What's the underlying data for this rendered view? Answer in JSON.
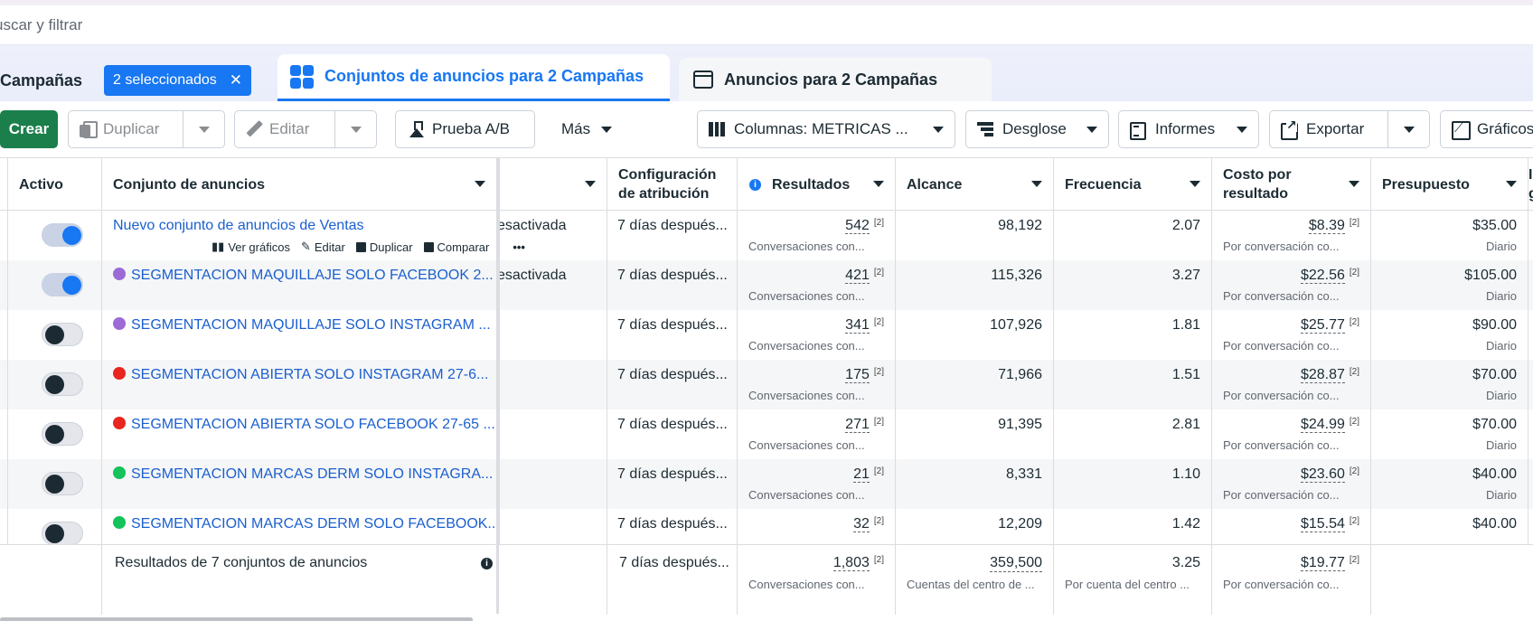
{
  "search": {
    "placeholder": "uscar y filtrar"
  },
  "tabs": {
    "campaigns_label": "Campañas",
    "selected_chip": "2 seleccionados",
    "adsets_label": "Conjuntos de anuncios para 2 Campañas",
    "ads_label": "Anuncios para 2 Campañas"
  },
  "toolbar": {
    "create": "Crear",
    "duplicate": "Duplicar",
    "edit": "Editar",
    "ab_test": "Prueba A/B",
    "more": "Más",
    "columns": "Columnas: METRICAS ...",
    "breakdown": "Desglose",
    "reports": "Informes",
    "export": "Exportar",
    "charts": "Gráficos"
  },
  "columns": {
    "active": "Activo",
    "adset": "Conjunto de anuncios",
    "attribution": "Configuración de atribución",
    "results": "Resultados",
    "reach": "Alcance",
    "frequency": "Frecuencia",
    "cost_per_result": "Costo por resultado",
    "budget": "Presupuesto",
    "cut_col": "I g"
  },
  "row_actions": {
    "view_charts": "Ver gráficos",
    "edit": "Editar",
    "duplicate": "Duplicar",
    "compare": "Comparar",
    "more": "•••"
  },
  "rows": [
    {
      "name": "Nuevo conjunto de anuncios de Ventas",
      "dot": "",
      "active": true,
      "delivery": "esactivada",
      "attribution": "7 días después...",
      "results": "542",
      "results_sub": "Conversaciones con...",
      "reach": "98,192",
      "frequency": "2.07",
      "cpr": "$8.39",
      "cpr_sub": "Por conversación co...",
      "budget": "$35.00",
      "budget_sub": "Diario"
    },
    {
      "name": "SEGMENTACION MAQUILLAJE SOLO FACEBOOK 2...",
      "dot": "#9c6bd6",
      "active": true,
      "delivery": "esactivada",
      "attribution": "7 días después...",
      "results": "421",
      "results_sub": "Conversaciones con...",
      "reach": "115,326",
      "frequency": "3.27",
      "cpr": "$22.56",
      "cpr_sub": "Por conversación co...",
      "budget": "$105.00",
      "budget_sub": "Diario"
    },
    {
      "name": "SEGMENTACION MAQUILLAJE SOLO INSTAGRAM ...",
      "dot": "#9c6bd6",
      "active": false,
      "delivery": "",
      "attribution": "7 días después...",
      "results": "341",
      "results_sub": "Conversaciones con...",
      "reach": "107,926",
      "frequency": "1.81",
      "cpr": "$25.77",
      "cpr_sub": "Por conversación co...",
      "budget": "$90.00",
      "budget_sub": "Diario"
    },
    {
      "name": "SEGMENTACION ABIERTA SOLO INSTAGRAM 27-6...",
      "dot": "#e8251e",
      "active": false,
      "delivery": "",
      "attribution": "7 días después...",
      "results": "175",
      "results_sub": "Conversaciones con...",
      "reach": "71,966",
      "frequency": "1.51",
      "cpr": "$28.87",
      "cpr_sub": "Por conversación co...",
      "budget": "$70.00",
      "budget_sub": "Diario"
    },
    {
      "name": "SEGMENTACION ABIERTA SOLO FACEBOOK 27-65 ...",
      "dot": "#e8251e",
      "active": false,
      "delivery": "",
      "attribution": "7 días después...",
      "results": "271",
      "results_sub": "Conversaciones con...",
      "reach": "91,395",
      "frequency": "2.81",
      "cpr": "$24.99",
      "cpr_sub": "Por conversación co...",
      "budget": "$70.00",
      "budget_sub": "Diario"
    },
    {
      "name": "SEGMENTACION MARCAS DERM SOLO INSTAGRA...",
      "dot": "#14c35a",
      "active": false,
      "delivery": "",
      "attribution": "7 días después...",
      "results": "21",
      "results_sub": "Conversaciones con...",
      "reach": "8,331",
      "frequency": "1.10",
      "cpr": "$23.60",
      "cpr_sub": "Por conversación co...",
      "budget": "$40.00",
      "budget_sub": "Diario"
    },
    {
      "name": "SEGMENTACION MARCAS DERM SOLO FACEBOOK...",
      "dot": "#14c35a",
      "active": false,
      "delivery": "",
      "attribution": "7 días después...",
      "results": "32",
      "results_sub": "",
      "reach": "12,209",
      "frequency": "1.42",
      "cpr": "$15.54",
      "cpr_sub": "",
      "budget": "$40.00",
      "budget_sub": ""
    }
  ],
  "footer": {
    "label": "Resultados de 7 conjuntos de anuncios",
    "attribution": "7 días después...",
    "results": "1,803",
    "results_sub": "Conversaciones con...",
    "reach": "359,500",
    "reach_sub": "Cuentas del centro de ...",
    "frequency": "3.25",
    "frequency_sub": "Por cuenta del centro ...",
    "cpr": "$19.77",
    "cpr_sub": "Por conversación co..."
  },
  "superscript": "[2]",
  "colors": {
    "accent": "#1877f2",
    "create_green": "#1a7f4b",
    "link": "#1b5fd0"
  }
}
